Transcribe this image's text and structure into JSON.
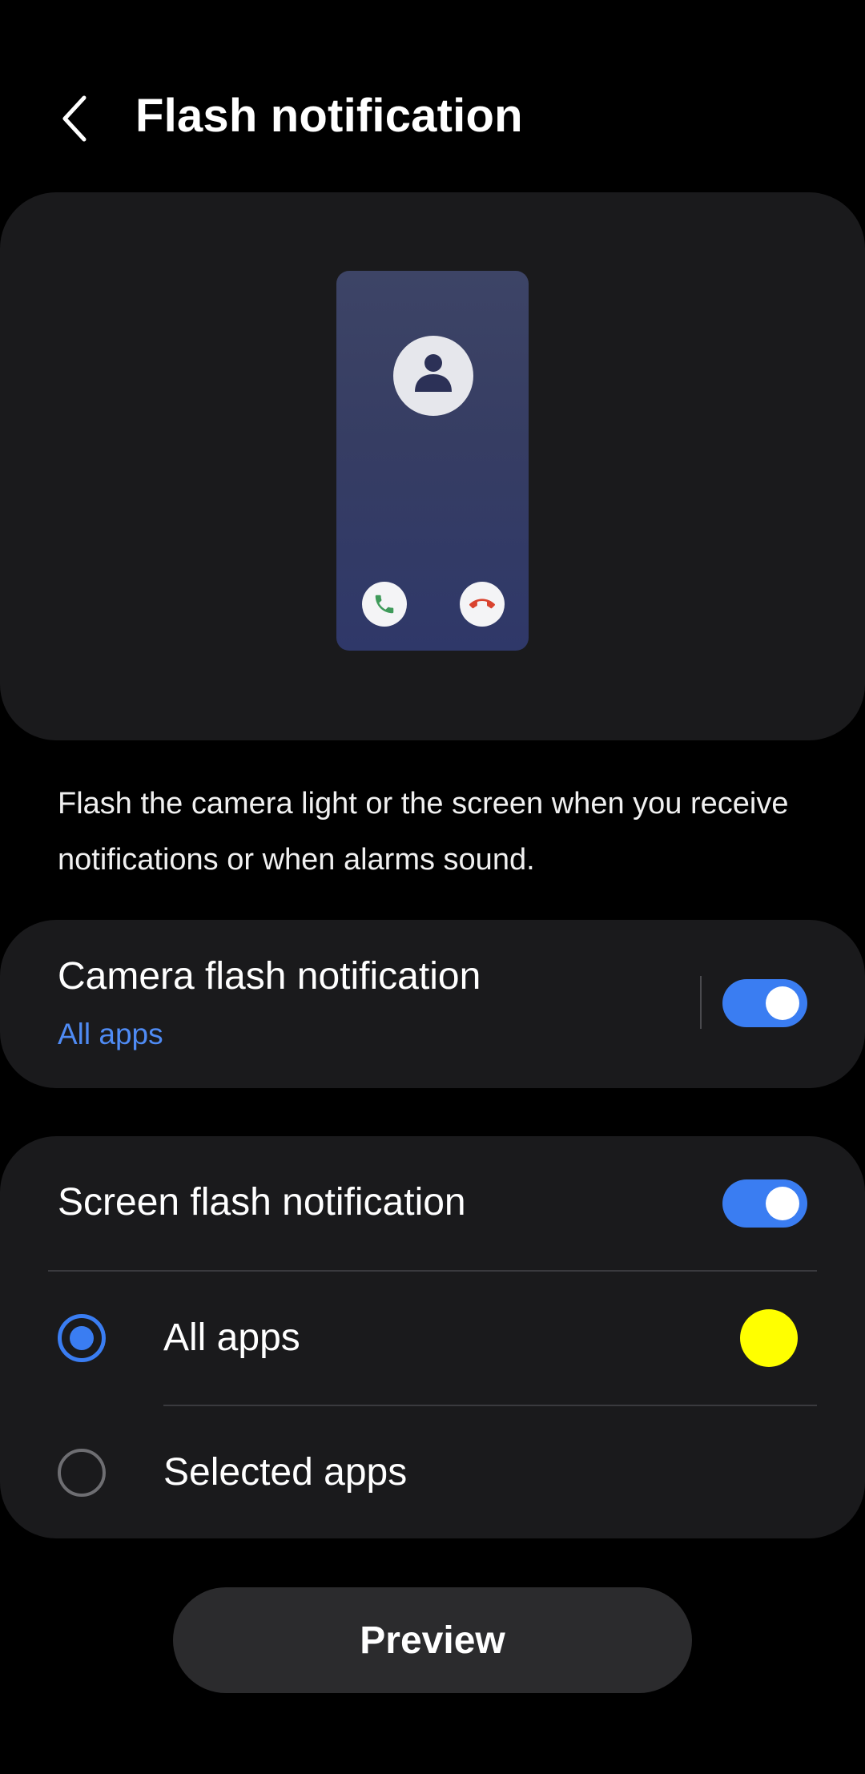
{
  "header": {
    "back_icon": "chevron-left-icon",
    "title": "Flash notification"
  },
  "illustration": {
    "avatar_icon": "person-icon",
    "accept_icon": "phone-accept-icon",
    "decline_icon": "phone-decline-icon",
    "accept_color": "#3f9a5a",
    "decline_color": "#d9432f"
  },
  "description": "Flash the camera light or the screen when you receive notifications or when alarms sound.",
  "camera_flash": {
    "title": "Camera flash notification",
    "subtitle": "All apps",
    "enabled": true
  },
  "screen_flash": {
    "title": "Screen flash notification",
    "enabled": true,
    "options": [
      {
        "label": "All apps",
        "selected": true,
        "color": "#ffff00"
      },
      {
        "label": "Selected apps",
        "selected": false
      }
    ]
  },
  "preview_label": "Preview",
  "colors": {
    "accent": "#3a7df2",
    "link": "#4f8bf4",
    "card": "#1a1a1c",
    "background": "#000000"
  }
}
